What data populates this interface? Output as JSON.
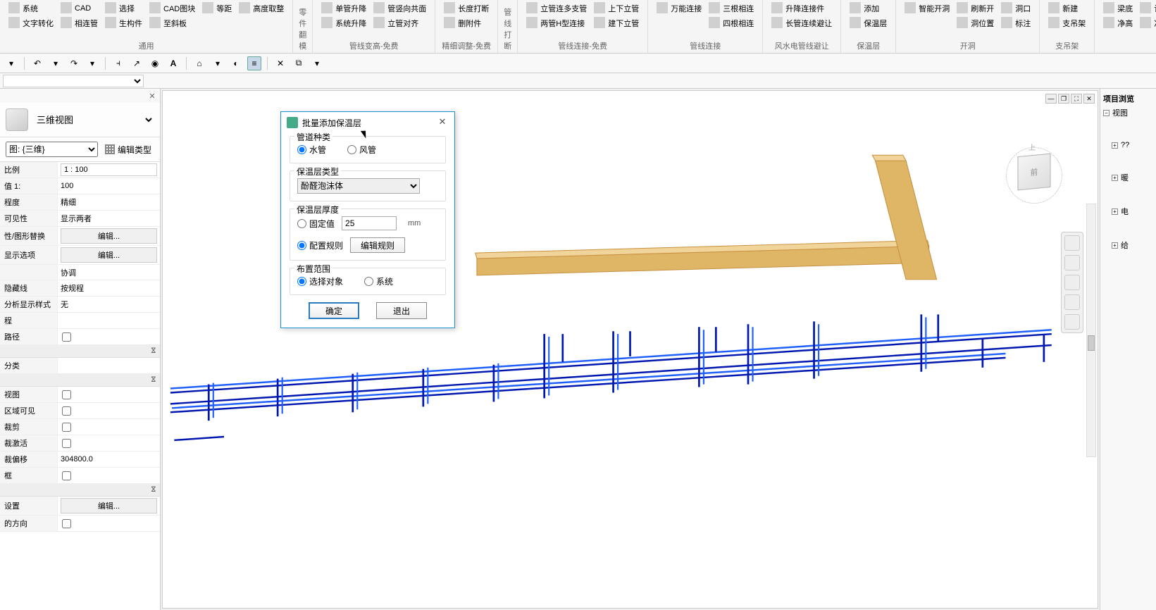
{
  "ribbon": {
    "groups": [
      {
        "label": "通用",
        "items": [
          [
            "系统",
            "CAD",
            "选择",
            "CAD图块",
            "等距",
            "高度取整"
          ],
          [
            "文字转化",
            "相连管",
            "生构件",
            "至斜板",
            "",
            ""
          ]
        ]
      },
      {
        "label": "零件翻模",
        "items": []
      },
      {
        "label": "管线变高-免费",
        "items": [
          [
            "单管升降",
            "管竖向共面"
          ],
          [
            "系统升降",
            "立管对齐"
          ]
        ]
      },
      {
        "label": "精细调整-免费",
        "items": [
          [
            "长度打断"
          ],
          [
            "删附件"
          ]
        ]
      },
      {
        "label": "管线打断",
        "items": []
      },
      {
        "label": "管线连接-免费",
        "items": [
          [
            "立管连多支管",
            "上下立管"
          ],
          [
            "两管H型连接",
            "建下立管"
          ]
        ]
      },
      {
        "label": "管线连接",
        "items": [
          [
            "万能连接",
            "三根相连"
          ],
          [
            "",
            "四根相连"
          ]
        ]
      },
      {
        "label": "风水电管线避让",
        "items": [
          [
            "升降连接件"
          ],
          [
            "长管连续避让"
          ]
        ]
      },
      {
        "label": "保温层",
        "items": [
          [
            "添加"
          ],
          [
            "保温层"
          ]
        ]
      },
      {
        "label": "开洞",
        "items": [
          [
            "智能开洞",
            "刷新开",
            "洞口"
          ],
          [
            "",
            "洞位置",
            "标注"
          ]
        ]
      },
      {
        "label": "支吊架",
        "items": [
          [
            "新建"
          ],
          [
            "支吊架"
          ]
        ]
      },
      {
        "label": "",
        "items": [
          [
            "梁底",
            "计算"
          ],
          [
            "净高",
            "净高"
          ]
        ]
      }
    ]
  },
  "leftPanel": {
    "viewType": "三维视图",
    "viewSelector": "图: {三维}",
    "editType": "编辑类型",
    "props": [
      {
        "type": "row",
        "label": "比例",
        "kind": "text",
        "value": "1 : 100"
      },
      {
        "type": "row",
        "label": "值 1:",
        "kind": "plain",
        "value": "100"
      },
      {
        "type": "row",
        "label": "程度",
        "kind": "plain",
        "value": "精细"
      },
      {
        "type": "row",
        "label": "可见性",
        "kind": "plain",
        "value": "显示两者"
      },
      {
        "type": "row",
        "label": "性/图形替换",
        "kind": "button",
        "value": "编辑..."
      },
      {
        "type": "row",
        "label": "显示选项",
        "kind": "button",
        "value": "编辑..."
      },
      {
        "type": "row",
        "label": "",
        "kind": "plain",
        "value": "协调"
      },
      {
        "type": "row",
        "label": "隐藏线",
        "kind": "plain",
        "value": "按规程"
      },
      {
        "type": "row",
        "label": "分析显示样式",
        "kind": "plain",
        "value": "无"
      },
      {
        "type": "row",
        "label": "程",
        "kind": "plain",
        "value": ""
      },
      {
        "type": "row",
        "label": "路径",
        "kind": "check",
        "value": false
      },
      {
        "type": "section",
        "label": ""
      },
      {
        "type": "row",
        "label": "分类",
        "kind": "plain",
        "value": ""
      },
      {
        "type": "section",
        "label": ""
      },
      {
        "type": "row",
        "label": "视图",
        "kind": "check",
        "value": false
      },
      {
        "type": "row",
        "label": "区域可见",
        "kind": "check",
        "value": false
      },
      {
        "type": "row",
        "label": "裁剪",
        "kind": "check",
        "value": false
      },
      {
        "type": "row",
        "label": "裁激活",
        "kind": "check",
        "value": false
      },
      {
        "type": "row",
        "label": "裁偏移",
        "kind": "plain",
        "value": "304800.0"
      },
      {
        "type": "row",
        "label": "框",
        "kind": "check",
        "value": false
      },
      {
        "type": "section",
        "label": ""
      },
      {
        "type": "row",
        "label": "设置",
        "kind": "button",
        "value": "编辑..."
      },
      {
        "type": "row",
        "label": "的方向",
        "kind": "check",
        "value": false
      }
    ]
  },
  "dialog": {
    "title": "批量添加保温层",
    "sec1": "管道种类",
    "opt1a": "水管",
    "opt1b": "风管",
    "sec2": "保温层类型",
    "typeSelect": "酚醛泡沫体",
    "sec3": "保温层厚度",
    "opt3a": "固定值",
    "thickVal": "25",
    "unit": "mm",
    "opt3b": "配置规则",
    "ruleBtn": "编辑规则",
    "sec4": "布置范围",
    "opt4a": "选择对象",
    "opt4b": "系统",
    "ok": "确定",
    "cancel": "退出"
  },
  "rightPanel": {
    "title": "项目浏览",
    "nodes": [
      "视图",
      "??",
      "暖",
      "电",
      "给"
    ]
  },
  "viewcube": {
    "front": "前",
    "top": "上"
  }
}
